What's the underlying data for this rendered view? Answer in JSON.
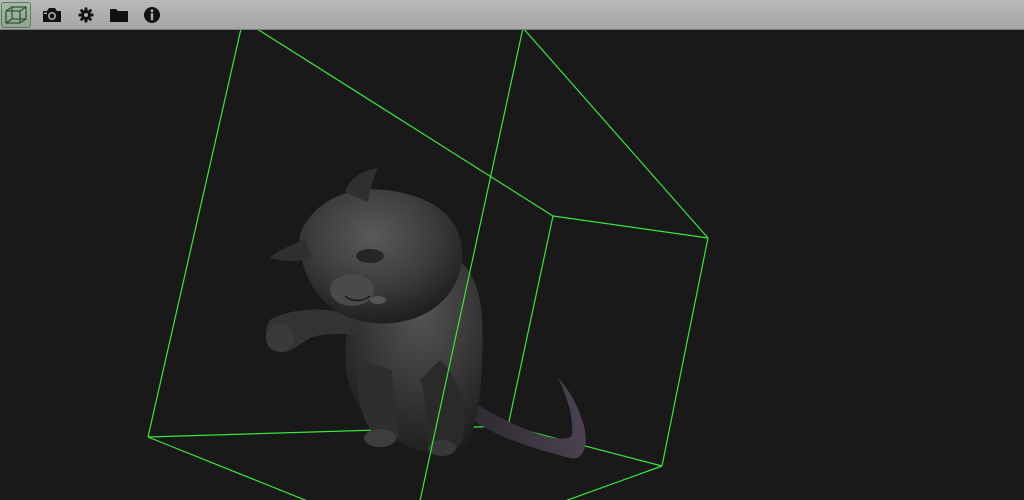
{
  "toolbar": {
    "buttons": [
      {
        "name": "bounding-box-toggle",
        "icon": "cube-wireframe-icon",
        "active": true
      },
      {
        "name": "screenshot",
        "icon": "camera-icon",
        "active": false
      },
      {
        "name": "settings",
        "icon": "gear-icon",
        "active": false
      },
      {
        "name": "open-file",
        "icon": "folder-icon",
        "active": false
      },
      {
        "name": "info",
        "icon": "info-icon",
        "active": false
      }
    ]
  },
  "viewport": {
    "background_color": "#191919",
    "bounding_box_color": "#39e639",
    "model": "cat-3d-model"
  }
}
